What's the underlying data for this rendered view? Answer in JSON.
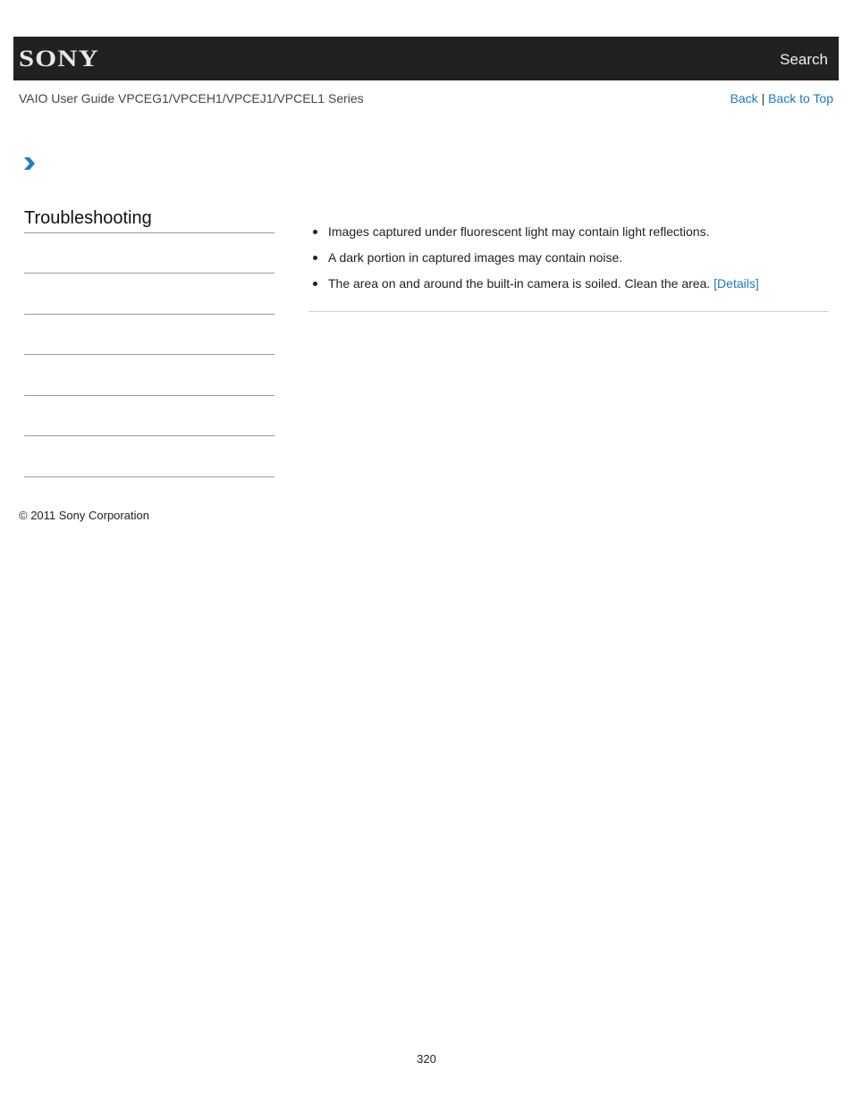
{
  "header": {
    "logo_text": "SONY",
    "search_label": "Search"
  },
  "subheader": {
    "guide_title": "VAIO User Guide VPCEG1/VPCEH1/VPCEJ1/VPCEL1 Series",
    "back_label": "Back",
    "separator": "|",
    "back_to_top_label": "Back to Top"
  },
  "breadcrumb": {
    "icon": "chevron-right-icon",
    "accent_color": "#1a7ac2"
  },
  "sidebar": {
    "title": "Troubleshooting",
    "items": [
      "",
      "",
      "",
      "",
      "",
      ""
    ]
  },
  "content": {
    "bullets": [
      {
        "text": "Images captured under fluorescent light may contain light reflections.",
        "link": null
      },
      {
        "text": "A dark portion in captured images may contain noise.",
        "link": null
      },
      {
        "text": "The area on and around the built-in camera is soiled. Clean the area. ",
        "link": "[Details]"
      }
    ]
  },
  "footer": {
    "copyright": "© 2011 Sony Corporation",
    "page_number": "320"
  }
}
